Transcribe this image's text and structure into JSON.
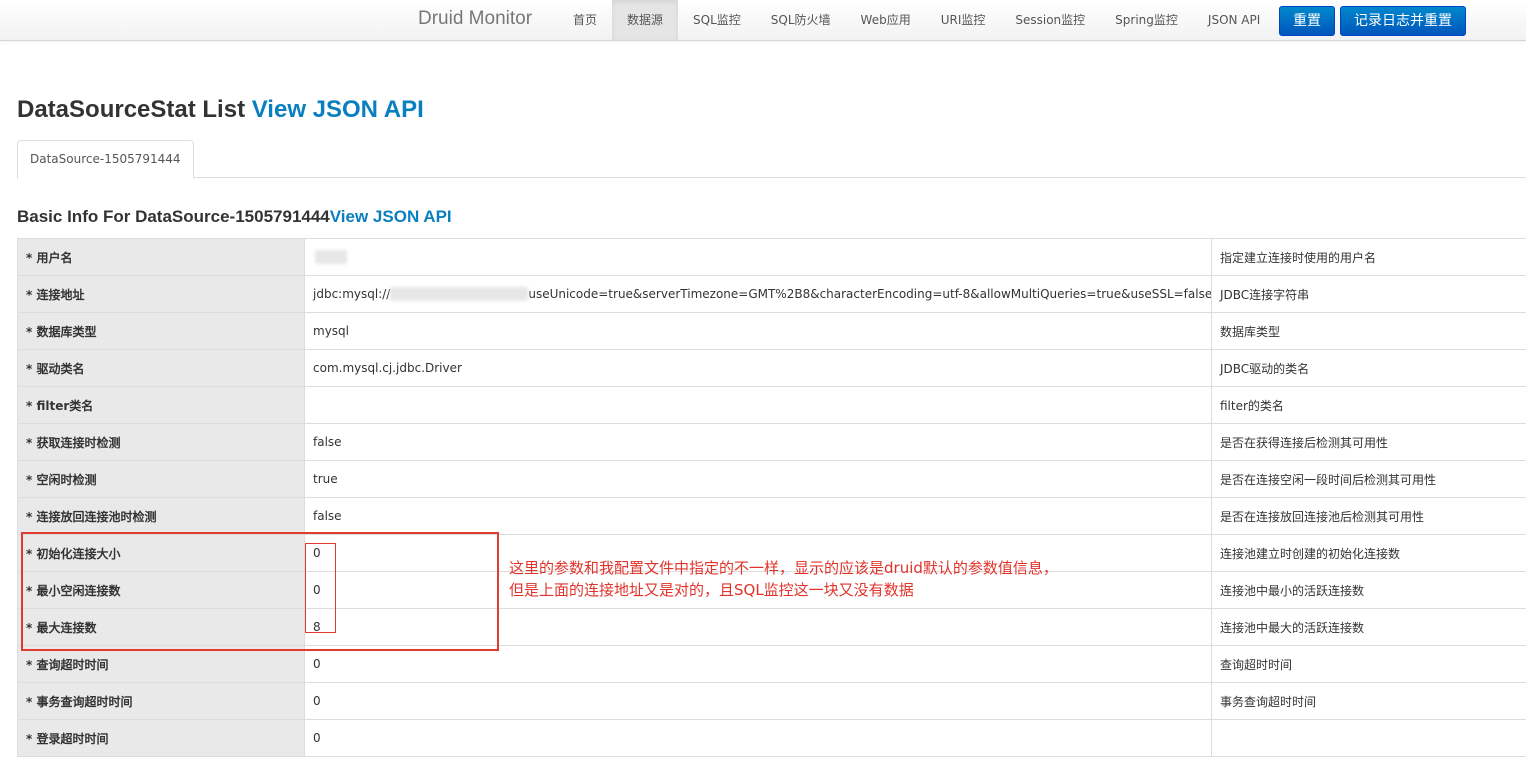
{
  "navbar": {
    "brand": "Druid Monitor",
    "items": [
      "首页",
      "数据源",
      "SQL监控",
      "SQL防火墙",
      "Web应用",
      "URI监控",
      "Session监控",
      "Spring监控",
      "JSON API"
    ],
    "active_index": 1,
    "reset_label": "重置",
    "log_reset_label": "记录日志并重置"
  },
  "page": {
    "title": "DataSourceStat List",
    "title_link": "View JSON API",
    "tab_label": "DataSource-1505791444",
    "section_title": "Basic Info For DataSource-1505791444",
    "section_link": "View JSON API"
  },
  "rows": [
    {
      "label": "* 用户名",
      "value": "",
      "desc": "指定建立连接时使用的用户名"
    },
    {
      "label": "* 连接地址",
      "value": "jdbc:mysql://",
      "value_suffix": "useUnicode=true&serverTimezone=GMT%2B8&characterEncoding=utf-8&allowMultiQueries=true&useSSL=false",
      "desc": "JDBC连接字符串"
    },
    {
      "label": "* 数据库类型",
      "value": "mysql",
      "desc": "数据库类型"
    },
    {
      "label": "* 驱动类名",
      "value": "com.mysql.cj.jdbc.Driver",
      "desc": "JDBC驱动的类名"
    },
    {
      "label": "* filter类名",
      "value": "",
      "desc": "filter的类名"
    },
    {
      "label": "* 获取连接时检测",
      "value": "false",
      "desc": "是否在获得连接后检测其可用性"
    },
    {
      "label": "* 空闲时检测",
      "value": "true",
      "desc": "是否在连接空闲一段时间后检测其可用性"
    },
    {
      "label": "* 连接放回连接池时检测",
      "value": "false",
      "desc": "是否在连接放回连接池后检测其可用性"
    },
    {
      "label": "* 初始化连接大小",
      "value": "0",
      "desc": "连接池建立时创建的初始化连接数"
    },
    {
      "label": "* 最小空闲连接数",
      "value": "0",
      "desc": "连接池中最小的活跃连接数"
    },
    {
      "label": "* 最大连接数",
      "value": "8",
      "desc": "连接池中最大的活跃连接数"
    },
    {
      "label": "* 查询超时时间",
      "value": "0",
      "desc": "查询超时时间"
    },
    {
      "label": "* 事务查询超时时间",
      "value": "0",
      "desc": "事务查询超时时间"
    },
    {
      "label": "* 登录超时时间",
      "value": "0",
      "desc": ""
    }
  ],
  "annotation": {
    "line1": "这里的参数和我配置文件中指定的不一样，显示的应该是druid默认的参数值信息，",
    "line2": "但是上面的连接地址又是对的，且SQL监控这一块又没有数据",
    "color": "#e0332b"
  },
  "colors": {
    "link": "#0a7fbf",
    "primary_button": "#0066cc",
    "label_cell_bg": "#e9e9e9"
  }
}
